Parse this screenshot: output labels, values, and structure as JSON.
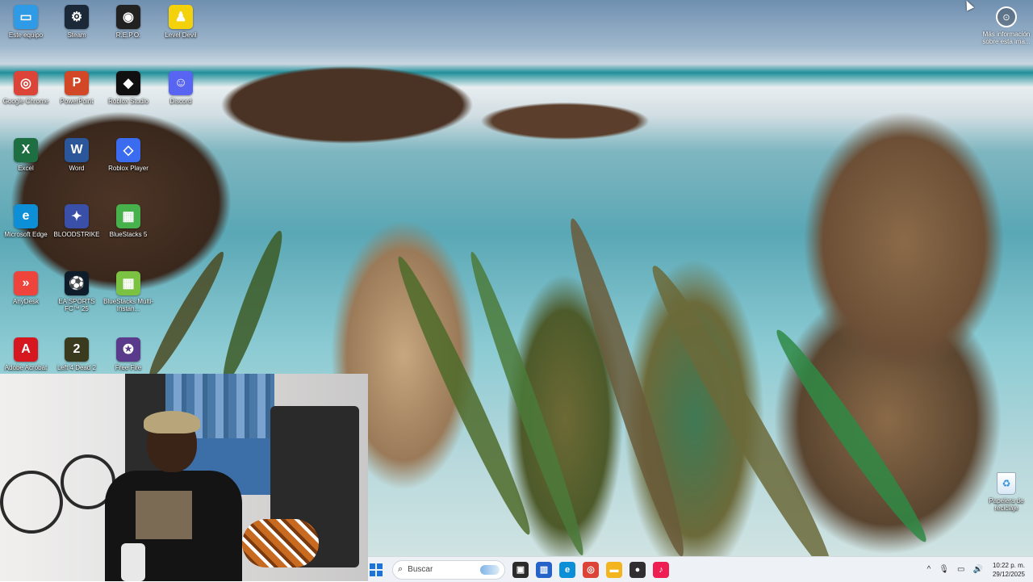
{
  "desktop_icons": [
    {
      "label": "Este equipo",
      "icon": "monitor-icon",
      "color": "#2f9be6",
      "glyph": "▭"
    },
    {
      "label": "Steam",
      "icon": "steam-icon",
      "color": "#1b2838",
      "glyph": "⚙"
    },
    {
      "label": "R.E.P.O.",
      "icon": "repo-game-icon",
      "color": "#222222",
      "glyph": "◉"
    },
    {
      "label": "Level Devil",
      "icon": "level-devil-icon",
      "color": "#f4d20b",
      "glyph": "♟"
    },
    {
      "label": "Google Chrome",
      "icon": "chrome-icon",
      "color": "#db4437",
      "glyph": "◎"
    },
    {
      "label": "PowerPoint",
      "icon": "powerpoint-icon",
      "color": "#d24726",
      "glyph": "P"
    },
    {
      "label": "Roblox Studio",
      "icon": "roblox-studio-icon",
      "color": "#101010",
      "glyph": "◆"
    },
    {
      "label": "Discord",
      "icon": "discord-icon",
      "color": "#5865f2",
      "glyph": "☺"
    },
    {
      "label": "Excel",
      "icon": "excel-icon",
      "color": "#1d6f42",
      "glyph": "X"
    },
    {
      "label": "Word",
      "icon": "word-icon",
      "color": "#2b579a",
      "glyph": "W"
    },
    {
      "label": "Roblox Player",
      "icon": "roblox-player-icon",
      "color": "#3b6cf0",
      "glyph": "◇"
    },
    {
      "label": "Microsoft Edge",
      "icon": "edge-icon",
      "color": "#0c8fd6",
      "glyph": "e"
    },
    {
      "label": "BLOODSTRIKE",
      "icon": "bloodstrike-icon",
      "color": "#3a4fa8",
      "glyph": "✦"
    },
    {
      "label": "BlueStacks 5",
      "icon": "bluestacks-icon",
      "color": "#47b14b",
      "glyph": "▦"
    },
    {
      "label": "AnyDesk",
      "icon": "anydesk-icon",
      "color": "#ef443b",
      "glyph": "»"
    },
    {
      "label": "EA SPORTS FC™ 25",
      "icon": "ea-fc-icon",
      "color": "#0f1d2a",
      "glyph": "⚽"
    },
    {
      "label": "BlueStacks Multi-Instan...",
      "icon": "bluestacks-multi-icon",
      "color": "#7cc242",
      "glyph": "▦"
    },
    {
      "label": "Adobe Acrobat",
      "icon": "acrobat-icon",
      "color": "#d7171f",
      "glyph": "A"
    },
    {
      "label": "Left 4 Dead 2",
      "icon": "left4dead2-icon",
      "color": "#3a3a1e",
      "glyph": "2"
    },
    {
      "label": "Free Fire",
      "icon": "free-fire-icon",
      "color": "#5a3a8a",
      "glyph": "✪"
    }
  ],
  "info_panel": {
    "label": "Más información sobre esta ima...",
    "icon": "camera-info-icon"
  },
  "recycle_bin": {
    "label": "Papelera de reciclaje",
    "icon": "recycle-bin-icon"
  },
  "taskbar": {
    "search_placeholder": "Buscar",
    "apps": [
      {
        "icon": "task-view-icon",
        "color": "#2b2b2b",
        "glyph": "▣"
      },
      {
        "icon": "store-icon",
        "color": "#2563c9",
        "glyph": "▥"
      },
      {
        "icon": "edge-taskbar-icon",
        "color": "#0c8fd6",
        "glyph": "e"
      },
      {
        "icon": "chrome-taskbar-icon",
        "color": "#db4437",
        "glyph": "◎"
      },
      {
        "icon": "file-explorer-icon",
        "color": "#f2b51e",
        "glyph": "▬"
      },
      {
        "icon": "obs-icon",
        "color": "#302e31",
        "glyph": "●"
      },
      {
        "icon": "tiktok-icon",
        "color": "#ee1d52",
        "glyph": "♪"
      }
    ],
    "tray": [
      {
        "icon": "chevron-up-icon",
        "glyph": "^"
      },
      {
        "icon": "microphone-icon",
        "glyph": "🎙"
      },
      {
        "icon": "network-icon",
        "glyph": "▭"
      },
      {
        "icon": "volume-icon",
        "glyph": "🔊"
      }
    ],
    "time": "10:22 p. m.",
    "date": "29/12/2025"
  }
}
